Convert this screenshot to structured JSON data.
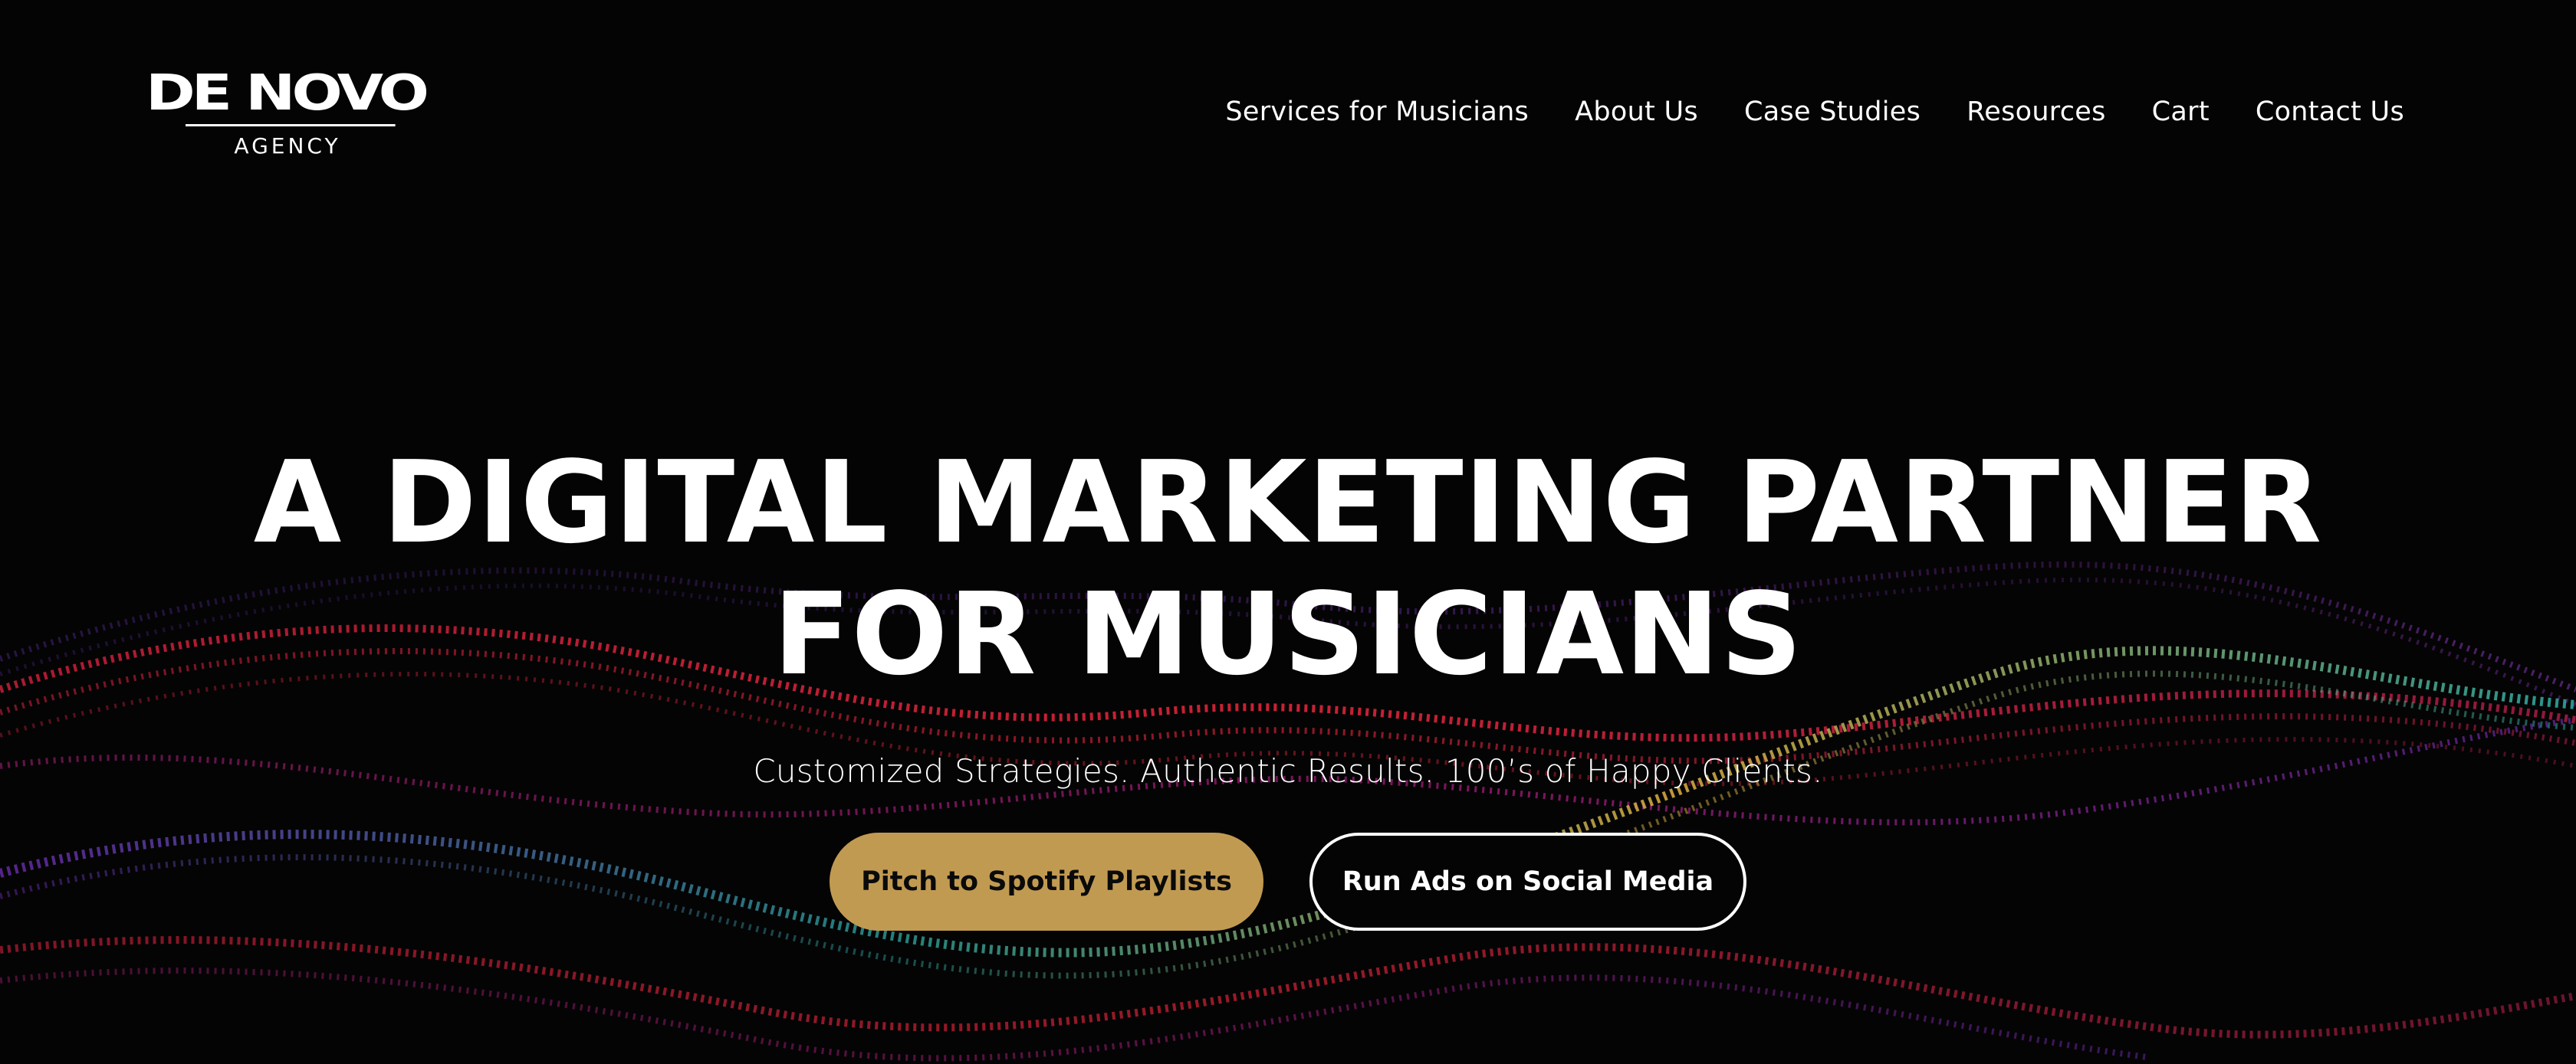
{
  "colors": {
    "background": "#040404",
    "text": "#ffffff",
    "primary_button": "#c19a52",
    "primary_button_text": "#0a0a0a",
    "wave_red": "#e0243a",
    "wave_magenta": "#c0208e",
    "wave_purple": "#7a2fc8",
    "wave_teal": "#2fb8b0",
    "wave_gold": "#e0b040"
  },
  "logo": {
    "name": "DE NOVO",
    "subtitle": "AGENCY"
  },
  "nav": {
    "items": [
      {
        "label": "Services for Musicians"
      },
      {
        "label": "About Us"
      },
      {
        "label": "Case Studies"
      },
      {
        "label": "Resources"
      },
      {
        "label": "Cart"
      },
      {
        "label": "Contact Us"
      }
    ]
  },
  "hero": {
    "title": "A DIGITAL MARKETING PARTNER FOR MUSICIANS",
    "subtitle": "Customized Strategies. Authentic Results. 100’s of Happy Clients.",
    "primary_cta": "Pitch to Spotify Playlists",
    "secondary_cta": "Run Ads on Social Media"
  },
  "background": {
    "icon": "particle-wave-background"
  }
}
